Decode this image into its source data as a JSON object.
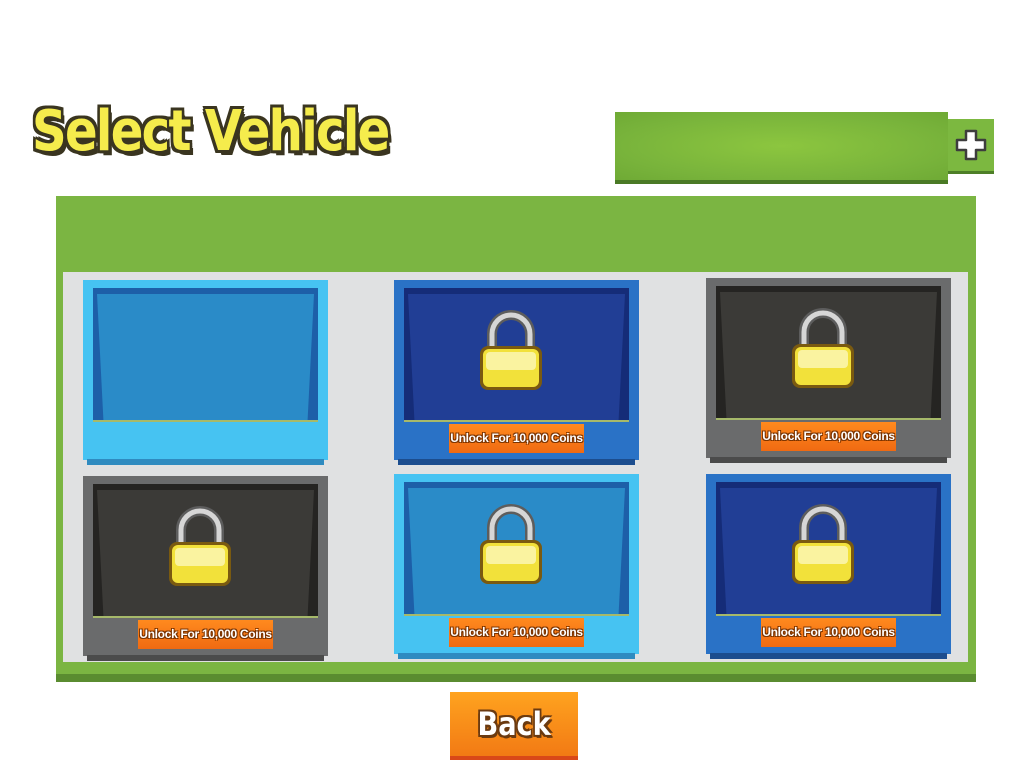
{
  "header": {
    "title": "Select Vehicle",
    "coin_add_icon": "plus-icon"
  },
  "vehicles": [
    {
      "theme": "light-blue",
      "locked": false,
      "unlock_label": ""
    },
    {
      "theme": "dark-blue",
      "locked": true,
      "unlock_label": "Unlock For 10,000 Coins"
    },
    {
      "theme": "dark-gray",
      "locked": true,
      "unlock_label": "Unlock For 10,000 Coins"
    },
    {
      "theme": "dark-gray",
      "locked": true,
      "unlock_label": "Unlock For 10,000 Coins"
    },
    {
      "theme": "light-blue",
      "locked": true,
      "unlock_label": "Unlock For 10,000 Coins"
    },
    {
      "theme": "dark-blue",
      "locked": true,
      "unlock_label": "Unlock For 10,000 Coins"
    }
  ],
  "footer": {
    "back_label": "Back"
  },
  "colors": {
    "accent_green": "#7bb542",
    "button_orange": "#f27a14",
    "title_yellow": "#f5ec4c",
    "lock_yellow": "#f2e13a"
  }
}
